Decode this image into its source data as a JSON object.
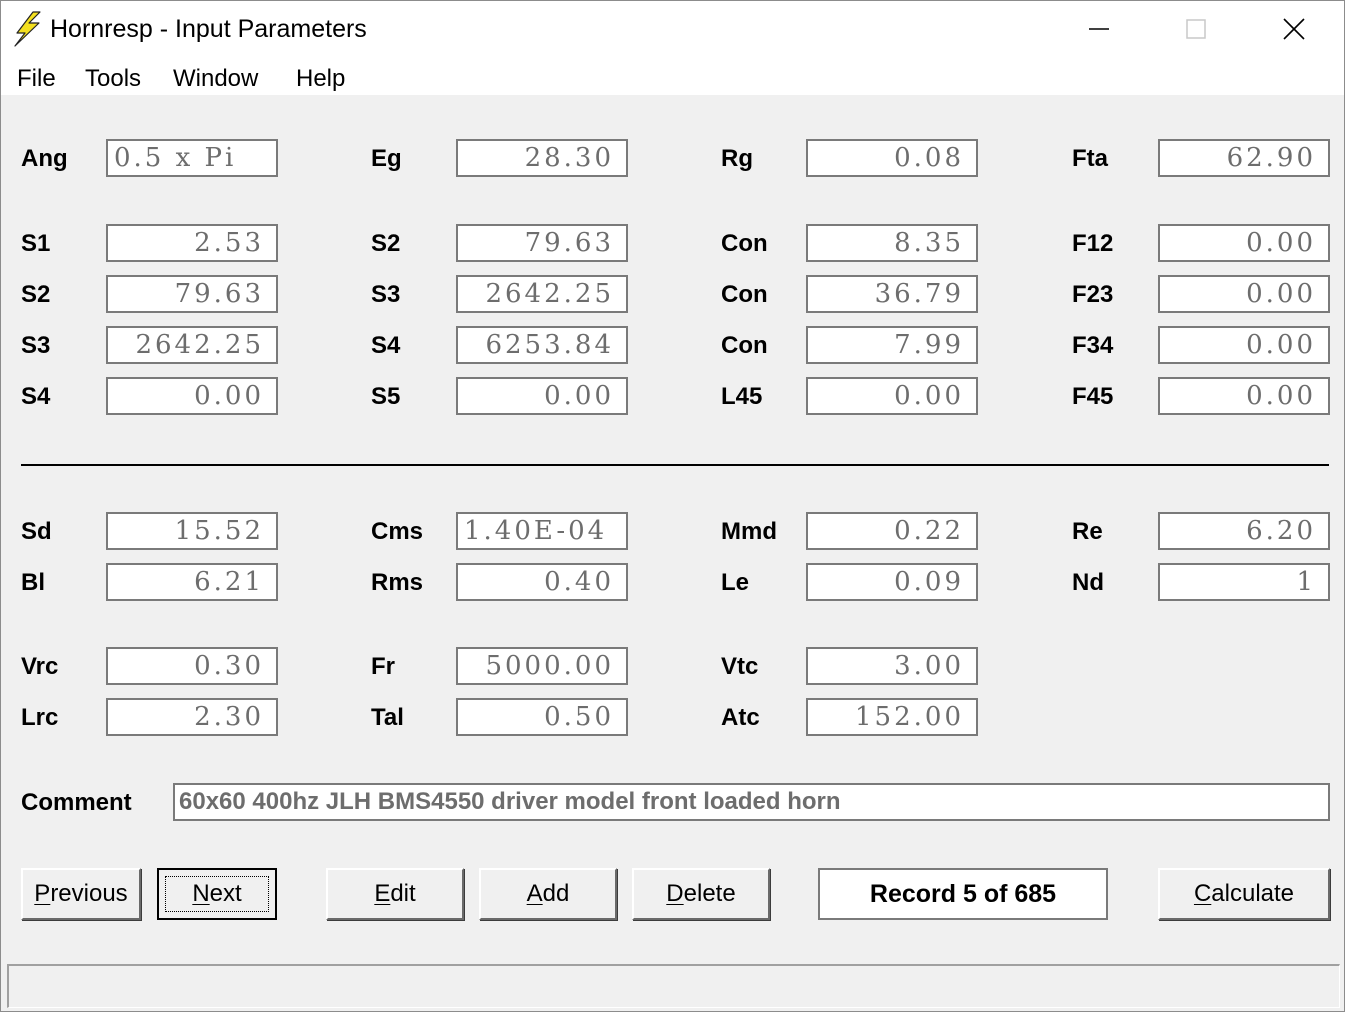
{
  "window": {
    "title": "Hornresp - Input Parameters"
  },
  "menu": [
    "File",
    "Tools",
    "Window",
    "Help"
  ],
  "params": {
    "Ang": "0.5 x Pi",
    "Eg": "28.30",
    "Rg": "0.08",
    "Fta": "62.90",
    "S1_r1": "2.53",
    "S2_r1": "79.63",
    "Con_r1": "8.35",
    "F12": "0.00",
    "S2_r2": "79.63",
    "S3_r2": "2642.25",
    "Con_r2": "36.79",
    "F23": "0.00",
    "S3_r3": "2642.25",
    "S4_r3": "6253.84",
    "Con_r3": "7.99",
    "F34": "0.00",
    "S4_r4": "0.00",
    "S5_r4": "0.00",
    "L45": "0.00",
    "F45": "0.00",
    "Sd": "15.52",
    "Cms": "1.40E-04",
    "Mmd": "0.22",
    "Re": "6.20",
    "Bl": "6.21",
    "Rms": "0.40",
    "Le": "0.09",
    "Nd": "1",
    "Vrc": "0.30",
    "Fr": "5000.00",
    "Vtc": "3.00",
    "Lrc": "2.30",
    "Tal": "0.50",
    "Atc": "152.00"
  },
  "comment": {
    "label": "Comment",
    "value": "60x60 400hz  JLH BMS4550 driver model front loaded horn"
  },
  "buttons": {
    "previous_u": "P",
    "previous_rest": "revious",
    "next_u": "N",
    "next_rest": "ext",
    "edit_u": "E",
    "edit_rest": "dit",
    "add_u": "A",
    "add_rest": "dd",
    "delete_u": "D",
    "delete_rest": "elete",
    "calculate_u": "C",
    "calculate_rest": "alculate"
  },
  "record": "Record 5 of 685"
}
